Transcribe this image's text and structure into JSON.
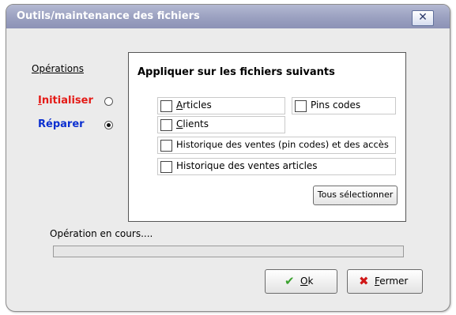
{
  "window": {
    "title": "Outils/maintenance des fichiers"
  },
  "operations": {
    "label": "Opérations",
    "items": [
      {
        "mnemonic": "I",
        "rest": "nitialiser",
        "selected": false,
        "color": "#e41b17"
      },
      {
        "mnemonic": "",
        "rest": "Réparer",
        "selected": true,
        "color": "#0b2fd0"
      }
    ]
  },
  "files": {
    "title": "Appliquer sur les fichiers suivants",
    "items": [
      {
        "mnemonic": "A",
        "rest": "rticles",
        "checked": false
      },
      {
        "mnemonic": "",
        "rest": "Pins codes",
        "checked": false
      },
      {
        "mnemonic": "C",
        "rest": "lients",
        "checked": false
      },
      {
        "mnemonic": "",
        "rest": "Historique des ventes (pin codes) et des accès",
        "checked": false
      },
      {
        "mnemonic": "",
        "rest": "Historique des ventes articles",
        "checked": false
      }
    ],
    "select_all_label": "Tous sélectionner"
  },
  "status": {
    "text": "Opération en cours....",
    "progress": 0
  },
  "buttons": {
    "ok": {
      "mnemonic": "O",
      "rest": "k",
      "icon": "checkmark-icon",
      "icon_color": "#3aa12e"
    },
    "close": {
      "mnemonic": "F",
      "rest": "ermer",
      "icon": "cross-icon",
      "icon_color": "#d01818"
    }
  }
}
